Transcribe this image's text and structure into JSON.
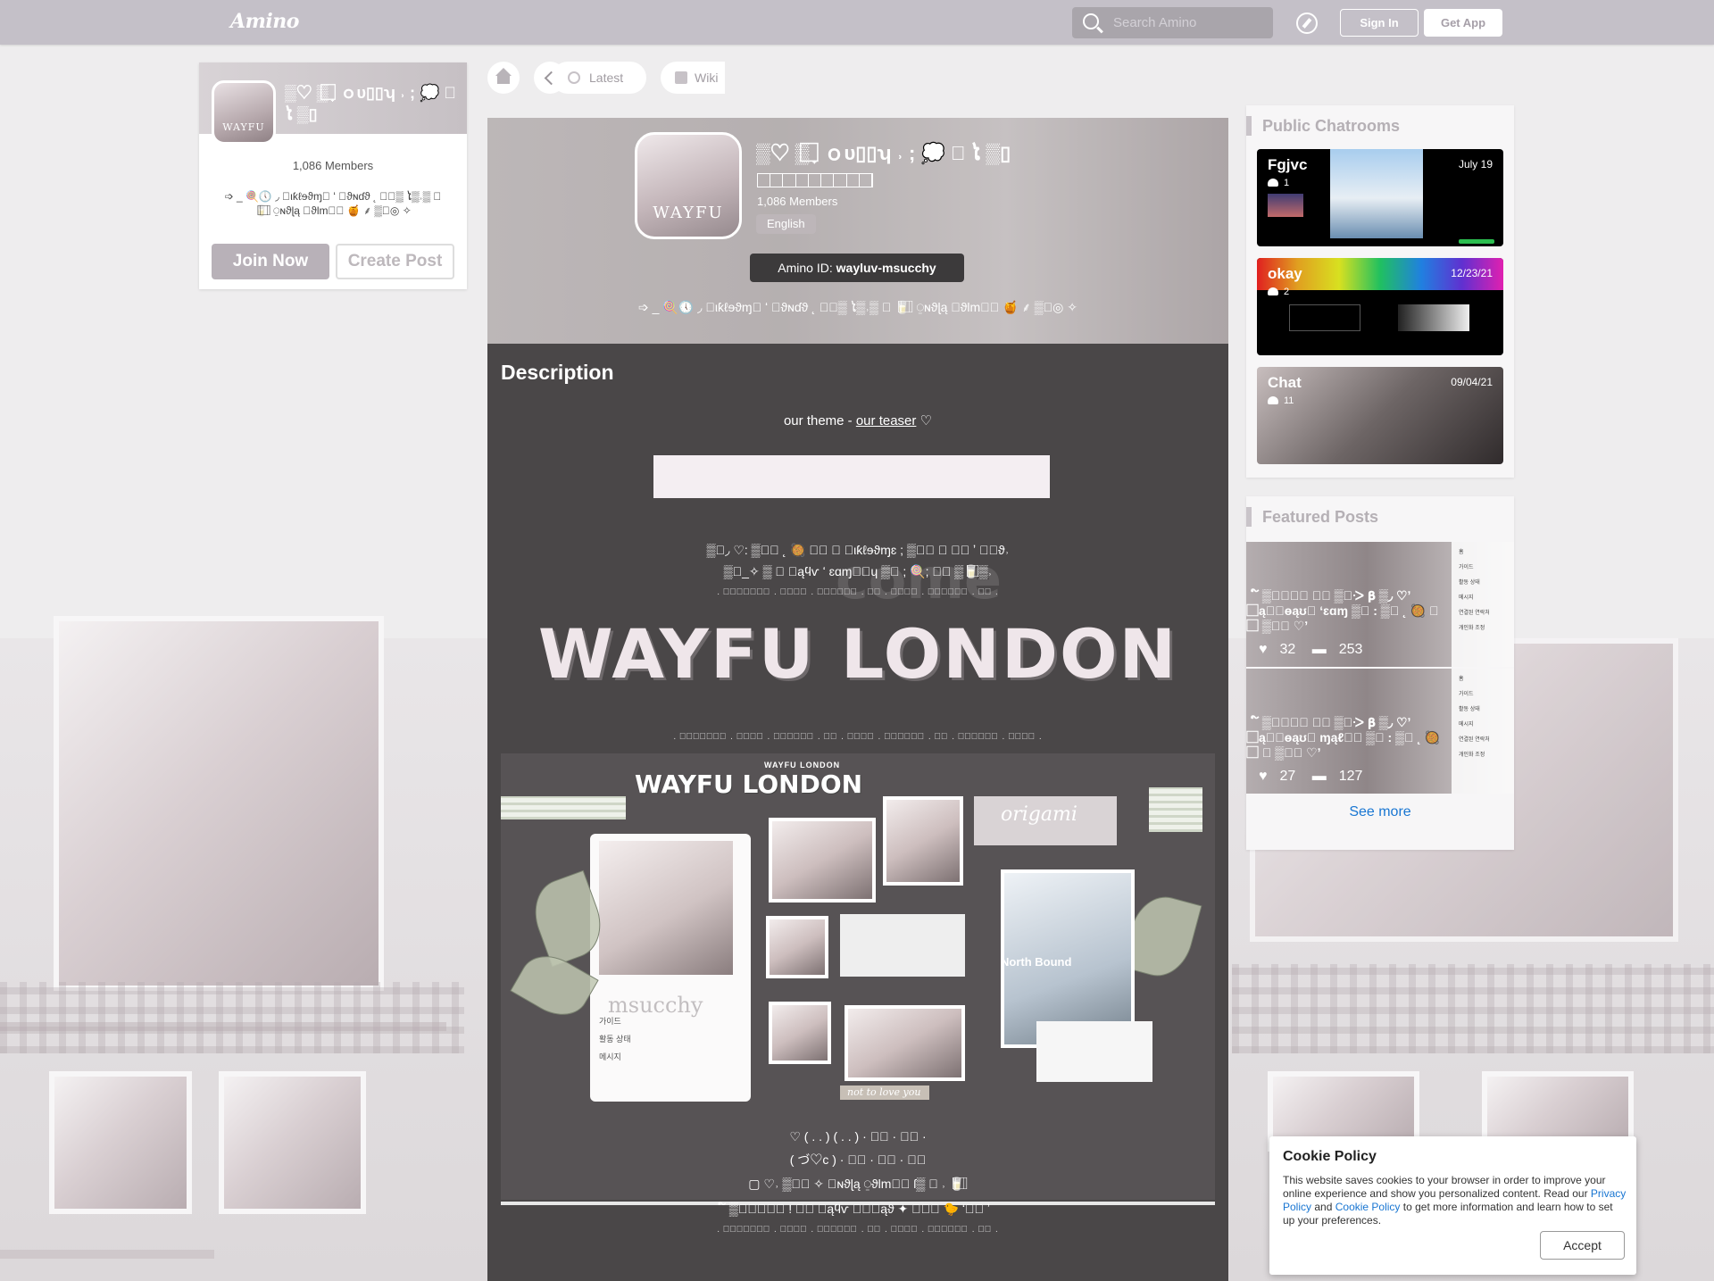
{
  "topbar": {
    "logo": "Amino",
    "search_placeholder": "Search Amino",
    "signin": "Sign In",
    "getapp": "Get App"
  },
  "community": {
    "name": "▒♡ ▒ ̟ ⃞ ｏυ▯▯ʮ ˒ ; 💭 ⃞ ໄ ▒▯",
    "members": "1,086 Members",
    "tagline": "➩ _ 🍭🕔 ◞ ⃞ιƙℓɘϑɱ⃞ ʻ ⃞ϑɴɗϑ  ˛ ⃞⃞▒ ໄ▒˒▒ ⃞ 🥛⃞⃞ ⃞⃞ ⍜ɴϑɭą ⃞ϑlm⃞⃞ 🍯 ⸙ ▒⃞◎ ✧",
    "join": "Join Now",
    "create": "Create Post",
    "language": "English",
    "amino_id_label": "Amino ID:",
    "amino_id": "wayluv-msucchy",
    "icon_text": "WAYFU"
  },
  "nav": {
    "latest": "Latest",
    "wiki": "Wiki"
  },
  "description": {
    "heading": "Description",
    "theme_prefix": "our theme -",
    "teaser_link": "our teaser",
    "theme_suffix": "♡",
    "glyph_line1": "▒⃞◞ ♡: ▒⃞𝛃 ˛ 🥘 ⃞⃞ ⃞ ⃞ιƙℓɘϑɱɛ ; ▒⃞⃞ ⃞ ⃞⃞ ʼ ⃞⃞ϑ˒",
    "glyph_line2": "▒⃞_✧ ▒ ⃞ ⃞ąϥѵ ʻ ɛɑɱ⃞⃞ɥ ▒⃞ ; 🍭; ⸙⃞ ▒🥛⃞⃞⃞▒˒",
    "dots_top": ". ⃞⃞⃞⃞⃞⃞⃞ . ⃞⃞⃞⃞ . ⃞⃞⃞⃞⃞⃞ . ⃞⃞ . ⃞⃞⃞⃞ . ⃞⃞⃞⃞⃞⃞ . ⃞⃞ .",
    "big_title": "WAYFU LONDON",
    "dots_mid": ". ⃞⃞⃞⃞⃞⃞⃞ . ⃞⃞⃞⃞ . ⃞⃞⃞⃞⃞⃞ . ⃞⃞ . ⃞⃞⃞⃞ . ⃞⃞⃞⃞⃞⃞ . ⃞⃞ . ⃞⃞⃞⃞⃞⃞ . ⃞⃞⃞⃞ .",
    "collage_small": "WAYFU LONDON",
    "collage_title": "WAYFU LONDON",
    "collage_origami": "origami",
    "collage_northbound": "North Bound",
    "collage_watermark": "msucchy",
    "collage_notlove": "not to love you",
    "collage_menu": "가이드\n활동 상태\n메시지",
    "bottom_line1": "♡        ( . . ) ( . . ) · ⃞⃞ · ⃞⃞ ·",
    "bottom_line2": "( づ♡c ) · ⃞⃞ · ⃞⃞ · ⃞⃞",
    "bottom_line3": "▢ ♡˒ ▒⃞⃞ ✧ ⃞ɴϑɭą ⍜ϑlm⃞⃞ ſ▒ ⃞ ˒ 🥛⃞⃞ ⃞⃞",
    "bottom_line4": "໌ ▒⃞⃞♡⃞⃞ ! ⸙⃞ ⃞ąϥѵ ⃞⃞⃞ąϑ ✦ ⃞⃞⃞ 🐤 ʻ♡⃞ ʼ",
    "bottom_dots": ". ⃞⃞⃞⃞⃞⃞⃞ . ⃞⃞⃞⃞ . ⃞⃞⃞⃞⃞⃞ . ⃞⃞ . ⃞⃞⃞⃞ . ⃞⃞⃞⃞⃞⃞ . ⃞⃞ ."
  },
  "sidebar": {
    "chatrooms_title": "Public Chatrooms",
    "chats": [
      {
        "name": "Fgjvc",
        "date": "July 19",
        "count": "1"
      },
      {
        "name": "okay",
        "date": "12/23/21",
        "count": "2"
      },
      {
        "name": "Chat",
        "date": "09/04/21",
        "count": "11"
      }
    ],
    "featured_title": "Featured Posts",
    "posts": [
      {
        "title": "໌ ▒⃞⃞♡⃞ ⸙⃞ ▒⃞ᑀ 𝛃 ▒◞ ♡ʼ ⃞ąⴰ⃞ɵąʊ⃞ ʻɛɑɱ ▒⃞ : ▒⃞ ˛ 🥘 ⃞ ⃞ ▒⃞⃞ ♡ʼ",
        "likes": "32",
        "comments": "253"
      },
      {
        "title": "໌ ▒⃞⃞♡⃞ ⸙⃞ ▒⃞ᑀ 𝛃 ▒◞ ♡ʼ ⃞ąⴰ⃞ɵąʊ⃞ ɱąℓ⃞⃞ ▒⃞ : ▒⃞ ˛ 🥘 ⃞ ⃞ ▒⃞⃞ ♡ʼ",
        "likes": "27",
        "comments": "127"
      }
    ],
    "see_more": "See more",
    "post_menu": "홈\n가이드\n활동 상태\n메시지\n연결된 연락처\n개인화 조정"
  },
  "cookie": {
    "title": "Cookie Policy",
    "text_before": "This website saves cookies to your browser in order to improve your online experience and show you personalized content. Read our",
    "privacy": "Privacy Policy",
    "and": "and",
    "cookie_link": "Cookie Policy",
    "text_after": "to get more information and learn how to set up your preferences.",
    "accept": "Accept"
  },
  "colors": {
    "topbar": "#c4c0c8",
    "accent_link": "#1976d2",
    "panel": "#4a4748",
    "page_bg": "#eeedee"
  }
}
